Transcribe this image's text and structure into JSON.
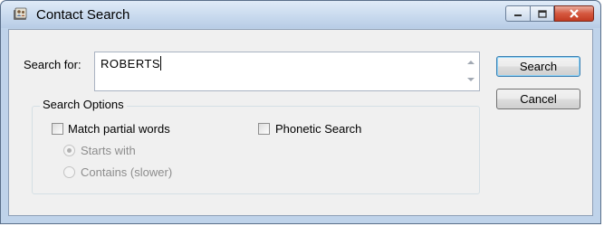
{
  "window": {
    "title": "Contact Search",
    "app_icon": "contacts-book-icon",
    "controls": [
      "minimize-icon",
      "maximize-icon",
      "close-icon"
    ]
  },
  "search": {
    "label": "Search for:",
    "value": "ROBERTS"
  },
  "buttons": {
    "search": "Search",
    "cancel": "Cancel"
  },
  "options": {
    "group_title": "Search Options",
    "match_partial": {
      "label": "Match partial words",
      "checked": false
    },
    "starts_with": {
      "label": "Starts with",
      "selected": true,
      "enabled": false
    },
    "contains": {
      "label": "Contains (slower)",
      "selected": false,
      "enabled": false
    },
    "phonetic": {
      "label": "Phonetic Search",
      "checked": false
    }
  },
  "colors": {
    "titlebar": "#cbdcef",
    "close_button": "#c23b22",
    "dialog_bg": "#f0f0f0"
  }
}
